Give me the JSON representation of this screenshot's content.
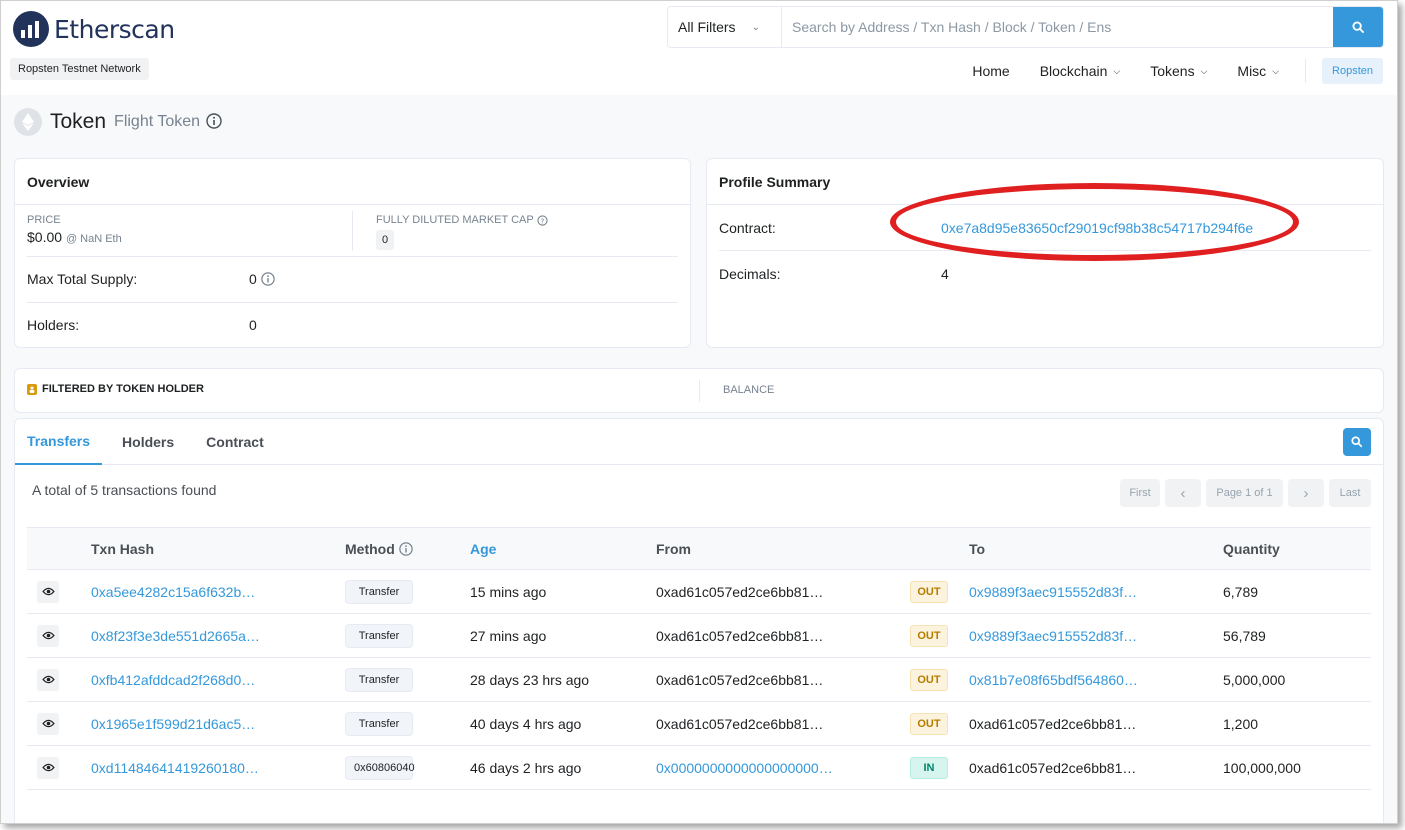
{
  "brand": {
    "name": "Etherscan",
    "network": "Ropsten Testnet Network"
  },
  "search": {
    "filter": "All Filters",
    "placeholder": "Search by Address / Txn Hash / Block / Token / Ens"
  },
  "nav": {
    "items": [
      "Home",
      "Blockchain",
      "Tokens",
      "Misc"
    ],
    "network_button": "Ropsten"
  },
  "page": {
    "title": "Token",
    "subtitle": "Flight Token"
  },
  "overview": {
    "heading": "Overview",
    "price_label": "PRICE",
    "price": "$0.00",
    "price_eth": "@ NaN Eth",
    "mcap_label": "FULLY DILUTED MARKET CAP",
    "mcap_value": "0",
    "max_supply_label": "Max Total Supply:",
    "max_supply": "0",
    "holders_label": "Holders:",
    "holders": "0"
  },
  "profile": {
    "heading": "Profile Summary",
    "contract_label": "Contract:",
    "contract": "0xe7a8d95e83650cf29019cf98b38c54717b294f6e",
    "decimals_label": "Decimals:",
    "decimals": "4"
  },
  "filter_bar": {
    "label": "FILTERED BY TOKEN HOLDER",
    "balance_label": "BALANCE"
  },
  "tabs": [
    "Transfers",
    "Holders",
    "Contract"
  ],
  "transfers": {
    "summary": "A total of 5 transactions found",
    "pager": {
      "first": "First",
      "prev": "‹",
      "page": "Page 1 of 1",
      "next": "›",
      "last": "Last"
    },
    "columns": [
      "Txn Hash",
      "Method",
      "Age",
      "From",
      "To",
      "Quantity"
    ],
    "rows": [
      {
        "hash": "0xa5ee4282c15a6f632b…",
        "method": "Transfer",
        "age": "15 mins ago",
        "from": "0xad61c057ed2ce6bb81…",
        "dir": "OUT",
        "to": "0x9889f3aec915552d83f…",
        "qty": "6,789"
      },
      {
        "hash": "0x8f23f3e3de551d2665a…",
        "method": "Transfer",
        "age": "27 mins ago",
        "from": "0xad61c057ed2ce6bb81…",
        "dir": "OUT",
        "to": "0x9889f3aec915552d83f…",
        "qty": "56,789"
      },
      {
        "hash": "0xfb412afddcad2f268d0…",
        "method": "Transfer",
        "age": "28 days 23 hrs ago",
        "from": "0xad61c057ed2ce6bb81…",
        "dir": "OUT",
        "to": "0x81b7e08f65bdf564860…",
        "qty": "5,000,000"
      },
      {
        "hash": "0x1965e1f599d21d6ac5…",
        "method": "Transfer",
        "age": "40 days 4 hrs ago",
        "from": "0xad61c057ed2ce6bb81…",
        "dir": "OUT",
        "to": "0xad61c057ed2ce6bb81…",
        "qty": "1,200"
      },
      {
        "hash": "0xd11484641419260180…",
        "method": "0x60806040",
        "age": "46 days 2 hrs ago",
        "from": "0x0000000000000000000…",
        "dir": "IN",
        "to": "0xad61c057ed2ce6bb81…",
        "qty": "100,000,000"
      }
    ]
  }
}
